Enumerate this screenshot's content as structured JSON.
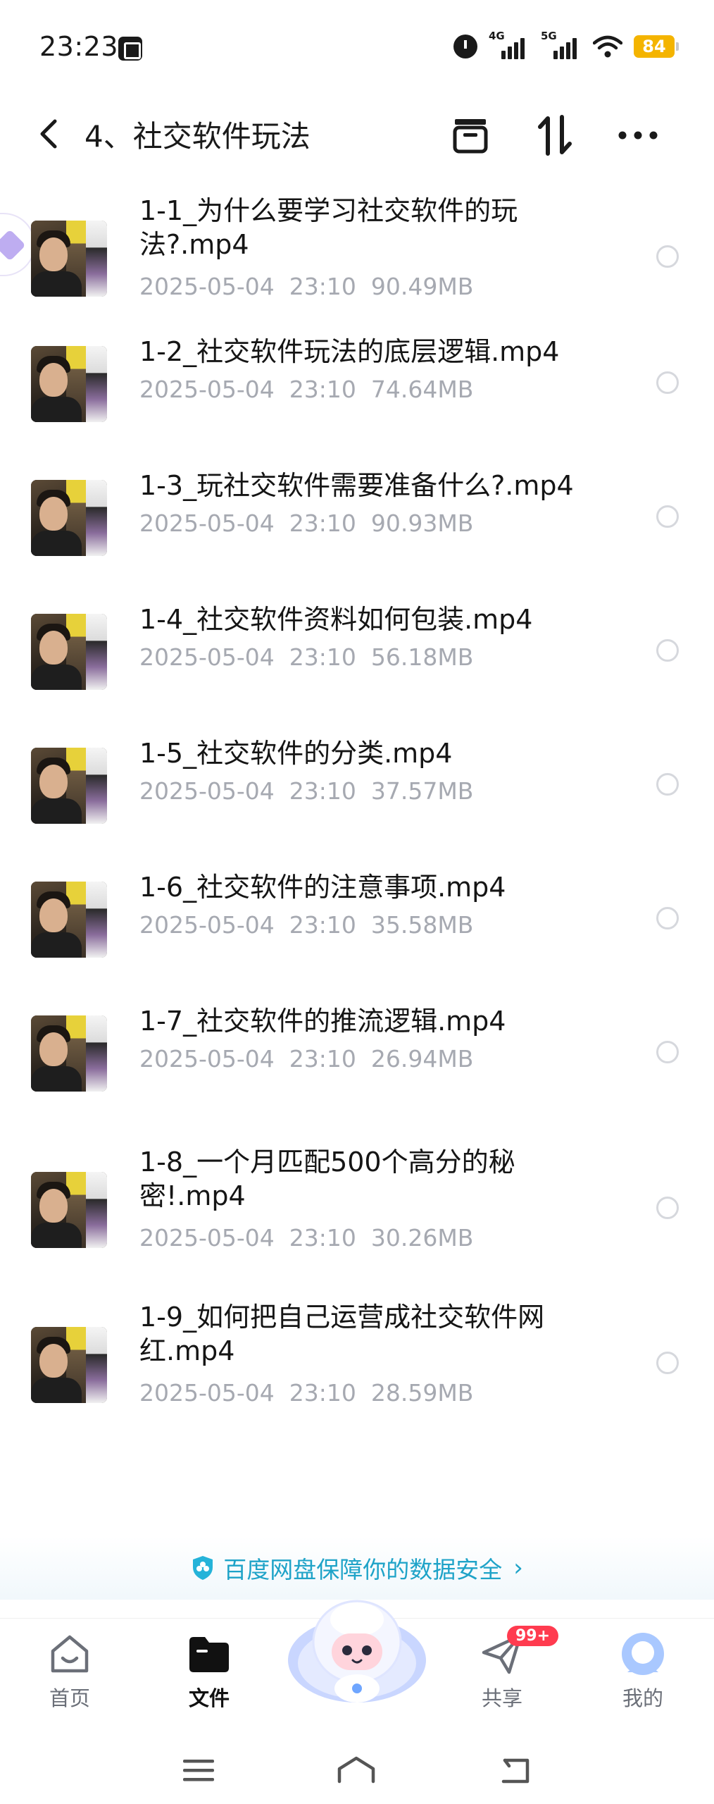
{
  "status_bar": {
    "time": "23:23",
    "network_1": "4G",
    "network_2": "5G",
    "battery": "84",
    "icons": [
      "app-icon",
      "alarm-icon",
      "signal-icon",
      "wifi-icon",
      "battery-icon"
    ]
  },
  "header": {
    "title": "4、社交软件玩法",
    "icons": [
      "back-icon",
      "archive-icon",
      "sort-icon",
      "more-icon"
    ]
  },
  "files": [
    {
      "name": "1-1_为什么要学习社交软件的玩法?.mp4",
      "date": "2025-05-04",
      "time": "23:10",
      "size": "90.49MB"
    },
    {
      "name": "1-2_社交软件玩法的底层逻辑.mp4",
      "date": "2025-05-04",
      "time": "23:10",
      "size": "74.64MB"
    },
    {
      "name": "1-3_玩社交软件需要准备什么?.mp4",
      "date": "2025-05-04",
      "time": "23:10",
      "size": "90.93MB"
    },
    {
      "name": "1-4_社交软件资料如何包装.mp4",
      "date": "2025-05-04",
      "time": "23:10",
      "size": "56.18MB"
    },
    {
      "name": "1-5_社交软件的分类.mp4",
      "date": "2025-05-04",
      "time": "23:10",
      "size": "37.57MB"
    },
    {
      "name": "1-6_社交软件的注意事项.mp4",
      "date": "2025-05-04",
      "time": "23:10",
      "size": "35.58MB"
    },
    {
      "name": "1-7_社交软件的推流逻辑.mp4",
      "date": "2025-05-04",
      "time": "23:10",
      "size": "26.94MB"
    },
    {
      "name": "1-8_一个月匹配500个高分的秘密!.mp4",
      "date": "2025-05-04",
      "time": "23:10",
      "size": "30.26MB"
    },
    {
      "name": "1-9_如何把自己运营成社交软件网红.mp4",
      "date": "2025-05-04",
      "time": "23:10",
      "size": "28.59MB"
    }
  ],
  "safety_banner": {
    "text": "百度网盘保障你的数据安全",
    "color": "#1fa3c8"
  },
  "bottom_nav": {
    "items": [
      {
        "label": "首页",
        "icon": "home-icon"
      },
      {
        "label": "文件",
        "icon": "folder-icon",
        "active": true
      },
      {
        "label": "共享",
        "icon": "share-icon",
        "badge": "99+"
      },
      {
        "label": "我的",
        "icon": "profile-icon"
      }
    ]
  },
  "system_nav": {
    "icons": [
      "menu-icon",
      "home-outline-icon",
      "back-arrow-icon"
    ]
  }
}
